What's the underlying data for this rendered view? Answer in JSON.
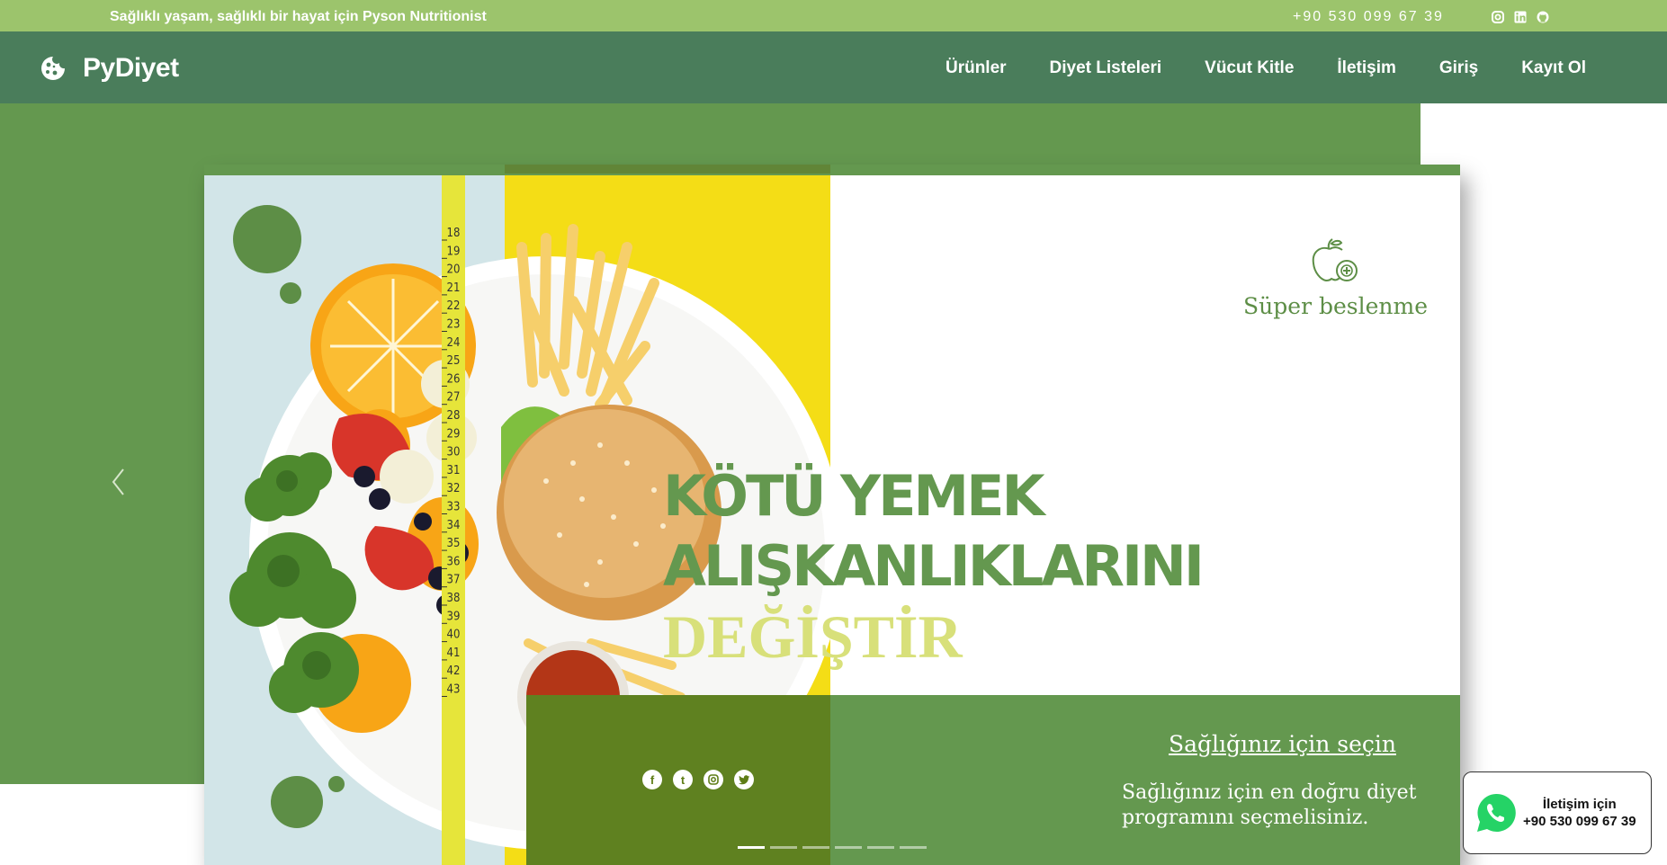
{
  "topbar": {
    "slogan": "Sağlıklı yaşam, sağlıklı bir hayat için Pyson Nutritionist",
    "phone": "+90 530 099 67 39",
    "social_icons": [
      "instagram-icon",
      "linkedin-icon",
      "github-icon"
    ]
  },
  "nav": {
    "brand": "PyDiyet",
    "items": [
      {
        "label": "Ürünler"
      },
      {
        "label": "Diyet Listeleri"
      },
      {
        "label": "Vücut Kitle"
      },
      {
        "label": "İletişim"
      },
      {
        "label": "Giriş"
      },
      {
        "label": "Kayıt Ol"
      }
    ]
  },
  "slide": {
    "brand_name": "Süper beslenme",
    "headline_line1": "KÖTÜ YEMEK",
    "headline_line2": "ALIŞKANLIKLARINI",
    "headline_accent": "DEĞİŞTİR",
    "cta_title": "Sağlığınız için seçin",
    "cta_text": "Sağlığınız için en doğru diyet programını seçmelisiniz.",
    "social_icons": [
      "facebook-icon",
      "tumblr-icon",
      "instagram-icon",
      "twitter-icon"
    ],
    "indicator_count": 6,
    "active_indicator": 1,
    "tape_numbers": [
      "18",
      "19",
      "20",
      "21",
      "22",
      "23",
      "24",
      "25",
      "26",
      "27",
      "28",
      "29",
      "30",
      "31",
      "32",
      "33",
      "34",
      "35",
      "36",
      "37",
      "38",
      "39",
      "40",
      "41",
      "42",
      "43"
    ]
  },
  "whatsapp": {
    "label": "İletişim için",
    "phone": "+90 530 099 67 39"
  },
  "colors": {
    "topbar": "#9cc46c",
    "nav": "#4a7d5b",
    "primary_green": "#64984f",
    "yellow": "#f4dd16",
    "accent_text": "#d8e07a"
  }
}
